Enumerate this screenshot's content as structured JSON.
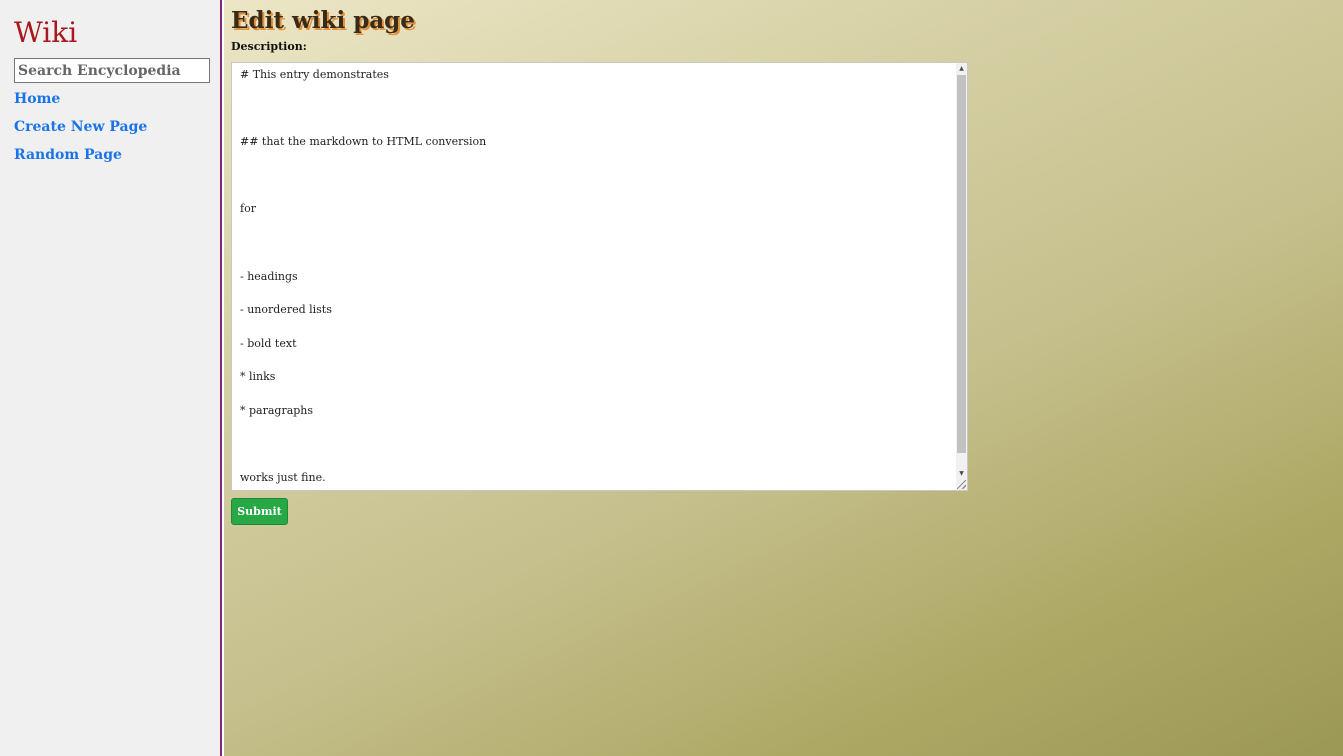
{
  "sidebar": {
    "brand": "Wiki",
    "search_placeholder": "Search Encyclopedia",
    "links": [
      {
        "label": "Home"
      },
      {
        "label": "Create New Page"
      },
      {
        "label": "Random Page"
      }
    ]
  },
  "main": {
    "title": "Edit wiki page",
    "description_label": "Description:",
    "description_value": "# This entry demonstrates\n\n\n\n## that the markdown to HTML conversion\n\n\n\nfor\n\n\n\n- headings\n\n- unordered lists\n\n- bold text\n\n* links\n\n* paragraphs\n\n\n\nworks just fine.",
    "submit_label": "Submit"
  },
  "colors": {
    "brand": "#a8181e",
    "link": "#1a73e8",
    "submit_bg": "#28a745",
    "sidebar_bg": "#f0f0f0",
    "sidebar_border": "#7a2c7a",
    "title_shadow": "#e0913a"
  },
  "icons": {
    "scroll_up": "scroll-up-arrow-icon",
    "scroll_down": "scroll-down-arrow-icon",
    "resize": "resize-grip-icon"
  }
}
